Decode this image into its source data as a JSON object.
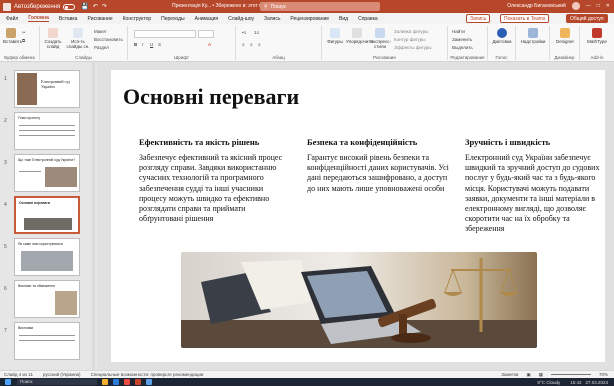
{
  "title_bar": {
    "autosave_label": "Автозбереження",
    "doc_title": "Презентація Ку... • Збережено в: этот компьютер",
    "search_placeholder": "Пошук",
    "user_name": "Олександр Бигановський",
    "user_initials": "ОБ"
  },
  "tabs": {
    "items": [
      "Файл",
      "Головна",
      "Вставка",
      "Рисование",
      "Конструктор",
      "Переходы",
      "Анимация",
      "Слайд-шоу",
      "Запись",
      "Рецензирование",
      "Вид",
      "Справка"
    ],
    "active": "Головна",
    "record_btn": "Запись",
    "present_btn": "Показать в Teams",
    "share_btn": "Общий доступ"
  },
  "ribbon": {
    "groups": [
      "Буфер обмена",
      "Слайды",
      "Шрифт",
      "Абзац",
      "Рисование",
      "Редактирование",
      "Голос",
      "Дизайнер",
      "Add-in"
    ],
    "paste": "Вставить",
    "new_slide": "Создать слайд",
    "reuse": "Исп-ть слайды сн.",
    "layout": "Макет",
    "reset": "Восстановить",
    "section": "Раздел",
    "shapes": "Фигуры",
    "arrange": "Упорядочить",
    "quick_styles": "Экспресс-стили",
    "fill": "Заливка фигуры",
    "outline": "Контур фигуры",
    "effects": "Эффекты фигуры",
    "find": "Найти",
    "replace": "Заменить",
    "select": "Выделить",
    "dictation": "Диктовка",
    "addins": "Надстройки",
    "designer": "Designer",
    "mathtype": "MathType"
  },
  "thumbnails": [
    {
      "num": "1",
      "title": "Електронний суд України"
    },
    {
      "num": "2",
      "title": "План проекту"
    },
    {
      "num": "3",
      "title": "Що таке Електронний суд України?"
    },
    {
      "num": "4",
      "title": "Основні переваги"
    },
    {
      "num": "5",
      "title": "Як саме ним користуватися"
    },
    {
      "num": "6",
      "title": "Виклики та обмеження"
    },
    {
      "num": "7",
      "title": "Висновки"
    }
  ],
  "slide": {
    "title": "Основні переваги",
    "columns": [
      {
        "heading": "Ефективність та якість рішень",
        "text": "Забезпечує ефективний та якісний процес розгляду справи. Завдяки використанню сучасних технологій та програмного забезпечення судді та інші учасники процесу можуть швидко та ефективно розглядати справи та приймати обґрунтовані рішення"
      },
      {
        "heading": "Безпека та конфіденційність",
        "text": "Гарантує високий рівень безпеки та конфіденційності даних користувачів. Усі дані передаються зашифровано, а доступ до них мають лише уповноважені особи"
      },
      {
        "heading": "Зручність і швидкість",
        "text": "Електронний суд України забезпечує швидкий та зручний доступ до судових послуг у будь-який час та з будь-якого місця. Користувачі можуть подавати заявки, документи та інші матеріали в електронному вигляді, що дозволяє скоротити час на їх обробку та збереження"
      }
    ]
  },
  "status_bar": {
    "slide_info": "Слайд 4 из 11",
    "language": "русский (Украина)",
    "accessibility": "Специальные возможности: проверьте рекомендации",
    "notes": "Заметки",
    "zoom": "70%"
  },
  "taskbar": {
    "search": "Поиск",
    "weather": "9°C Cloudy",
    "time": "15:42",
    "date": "27.03.2023"
  },
  "colors": {
    "accent": "#b7472a",
    "share": "#b7472a"
  }
}
